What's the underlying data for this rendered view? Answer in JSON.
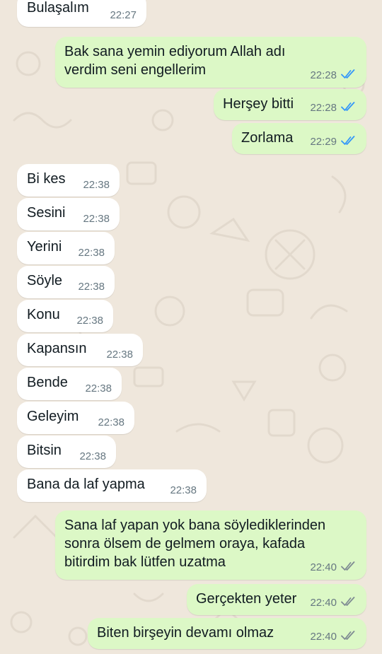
{
  "colors": {
    "wallpaper": "#efe7dc",
    "incoming_bubble": "#ffffff",
    "outgoing_bubble": "#dcf8c6",
    "read_tick": "#3497f9",
    "delivered_tick": "#7f8b93",
    "timestamp": "#667781"
  },
  "messages": [
    {
      "dir": "in",
      "text": "Bulaşalım",
      "time": "22:27"
    },
    {
      "dir": "out",
      "text": "Bak sana yemin ediyorum Allah adı\nverdim seni engellerim",
      "time": "22:28",
      "status": "read"
    },
    {
      "dir": "out",
      "text": "Herşey bitti",
      "time": "22:28",
      "status": "read"
    },
    {
      "dir": "out",
      "text": "Zorlama",
      "time": "22:29",
      "status": "read"
    },
    {
      "dir": "in",
      "text": "Bi kes",
      "time": "22:38"
    },
    {
      "dir": "in",
      "text": "Sesini",
      "time": "22:38"
    },
    {
      "dir": "in",
      "text": "Yerini",
      "time": "22:38"
    },
    {
      "dir": "in",
      "text": "Söyle",
      "time": "22:38"
    },
    {
      "dir": "in",
      "text": "Konu",
      "time": "22:38"
    },
    {
      "dir": "in",
      "text": "Kapansın",
      "time": "22:38"
    },
    {
      "dir": "in",
      "text": "Bende",
      "time": "22:38"
    },
    {
      "dir": "in",
      "text": "Geleyim",
      "time": "22:38"
    },
    {
      "dir": "in",
      "text": "Bitsin",
      "time": "22:38"
    },
    {
      "dir": "in",
      "text": "Bana da laf yapma",
      "time": "22:38"
    },
    {
      "dir": "out",
      "text": "Sana laf yapan yok bana söylediklerinden\nsonra ölsem de gelmem oraya, kafada\nbitirdim bak lütfen uzatma",
      "time": "22:40",
      "status": "delivered"
    },
    {
      "dir": "out",
      "text": "Gerçekten yeter",
      "time": "22:40",
      "status": "delivered"
    },
    {
      "dir": "out",
      "text": "Biten birşeyin devamı olmaz",
      "time": "22:40",
      "status": "delivered"
    }
  ]
}
